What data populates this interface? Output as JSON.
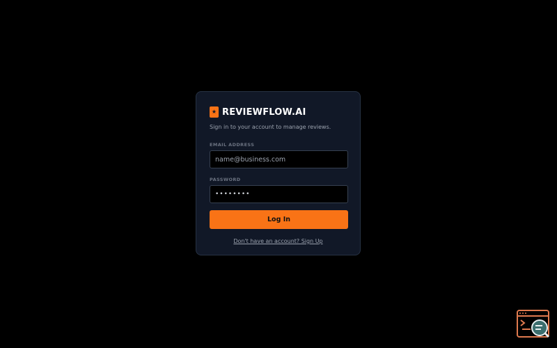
{
  "brand": {
    "name": "REVIEWFLOW.AI",
    "icon": "star-icon",
    "icon_glyph": "★",
    "tagline": "Sign in to your account to manage reviews."
  },
  "form": {
    "email_label": "EMAIL ADDRESS",
    "email_placeholder": "name@business.com",
    "email_value": "",
    "password_label": "PASSWORD",
    "password_value": "••••••••",
    "login_label": "Log In",
    "signup_link": "Don't have an account? Sign Up"
  },
  "corner_widget": {
    "icon": "terminal-search-icon"
  },
  "colors": {
    "background": "#000000",
    "card": "#111827",
    "accent": "#f97316",
    "muted_text": "#9ca3af"
  }
}
